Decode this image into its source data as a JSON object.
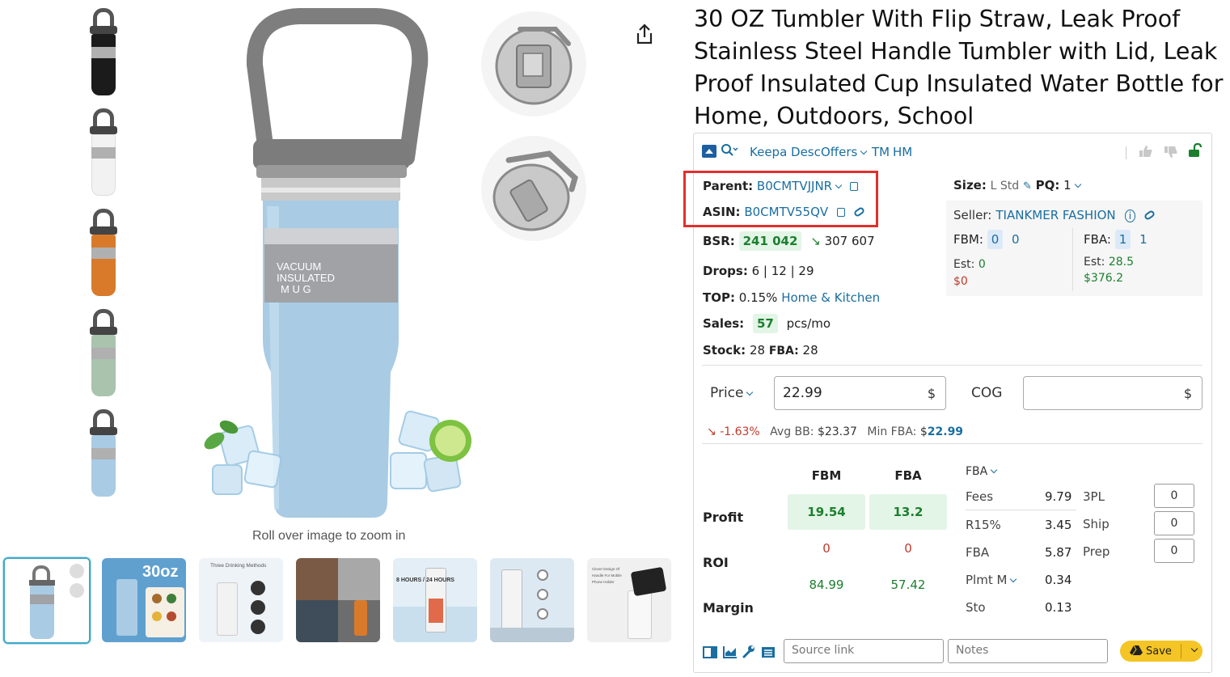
{
  "product": {
    "title": "30 OZ Tumbler With Flip Straw, Leak Proof Stainless Steel Handle Tumbler with Lid, Leak Proof Insulated Cup Insulated Water Bottle for Home, Outdoors, School",
    "zoom_hint": "Roll over image to zoom in",
    "main_image_label": [
      "VACUUM",
      "INSULATED",
      "M  U  G"
    ],
    "capacity_label": "30oz",
    "thumbnails_vertical": [
      {
        "color": "#1b1b1b"
      },
      {
        "color": "#f2f2f2"
      },
      {
        "color": "#d97a2b"
      },
      {
        "color": "#a9c3ad"
      },
      {
        "color": "#a9cbe4"
      }
    ],
    "thumbnails_bottom": [
      {
        "caption": ""
      },
      {
        "caption": "30oz"
      },
      {
        "caption": "Three Drinking Methods"
      },
      {
        "caption": ""
      },
      {
        "caption": "8 HOURS / 24 HOURS"
      },
      {
        "caption": ""
      },
      {
        "caption": "Clever Design Of Handle For Mobile Phone Holder"
      }
    ]
  },
  "keepa": {
    "tabs": {
      "desc": "Keepa Desc",
      "offers": "Offers",
      "tm": "TM",
      "hm": "HM"
    },
    "parent_label": "Parent:",
    "parent_asin": "B0CMTVJJNR",
    "asin_label": "ASIN:",
    "asin": "B0CMTV55QV",
    "bsr_label": "BSR:",
    "bsr": "241 042",
    "bsr_avg": "307 607",
    "drops_label": "Drops:",
    "drops": "6 | 12 | 29",
    "top_label": "TOP:",
    "top_pct": "0.15%",
    "top_category": "Home & Kitchen",
    "sales_label": "Sales:",
    "sales": "57",
    "sales_unit": "pcs/mo",
    "stock_label": "Stock:",
    "stock": "28",
    "stock_fba_label": "FBA:",
    "stock_fba": "28",
    "size_label": "Size:",
    "size": "L Std",
    "pq_label": "PQ:",
    "pq": "1",
    "seller_label": "Seller:",
    "seller": "TIANKMER FASHION",
    "fbm_label": "FBM:",
    "fbm_count": "0",
    "fbm_count2": "0",
    "fba_label": "FBA:",
    "fba_count": "1",
    "fba_count2": "1",
    "est_label": "Est:",
    "fbm_est": "0",
    "fbm_est_money": "$0",
    "fba_est": "28.5",
    "fba_est_money": "$376.2",
    "price_label": "Price",
    "price_value": "22.99",
    "cog_label": "COG",
    "cog_value": "",
    "currency": "$",
    "price_change": "-1.63%",
    "avg_bb_label": "Avg BB:",
    "avg_bb": "$23.37",
    "min_fba_label": "Min FBA:",
    "min_fba_currency": "$",
    "min_fba": "22.99",
    "col_fbm": "FBM",
    "col_fba": "FBA",
    "profit_label": "Profit",
    "roi_label": "ROI",
    "margin_label": "Margin",
    "profit_fbm": "19.54",
    "profit_fba": "13.2",
    "roi_fbm": "0",
    "roi_fba": "0",
    "margin_fbm": "84.99",
    "margin_fba": "57.42",
    "fee_mode": "FBA",
    "fees": [
      {
        "label": "Fees",
        "value": "9.79",
        "extra": "3PL",
        "input": "0"
      },
      {
        "label": "R15%",
        "value": "3.45",
        "extra": "Ship",
        "input": "0"
      },
      {
        "label": "FBA",
        "value": "5.87",
        "extra": "Prep",
        "input": "0"
      },
      {
        "label": "Plmt M",
        "value": "0.34",
        "extra": "",
        "input": ""
      },
      {
        "label": "Sto",
        "value": "0.13",
        "extra": "",
        "input": ""
      }
    ],
    "source_link_placeholder": "Source link",
    "notes_placeholder": "Notes",
    "save_label": "Save"
  },
  "colors": {
    "accent_blue": "#1a6ea0",
    "green": "#1b7f2f",
    "red": "#c0392b",
    "highlight": "#e0302b",
    "save_button": "#f4c524",
    "tumbler_blue": "#a9cbe4"
  }
}
